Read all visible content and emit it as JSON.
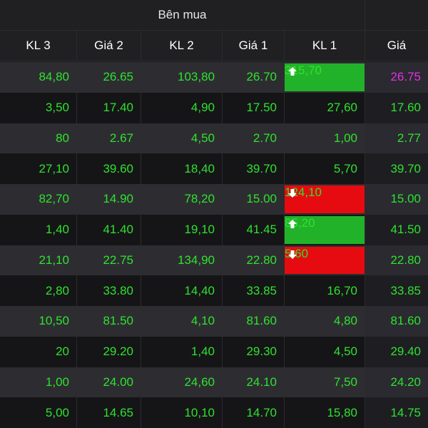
{
  "header": {
    "group_title": "Bên mua",
    "columns": [
      "KL 3",
      "Giá 2",
      "KL 2",
      "Giá 1",
      "KL 1",
      "Giá"
    ]
  },
  "colors": {
    "green_text": "#2fe12f",
    "up_bg": "#22b229",
    "down_bg": "#e60b10",
    "magenta": "#e62fe6"
  },
  "rows": [
    {
      "kl3": "84,80",
      "gia2": "26.65",
      "kl2": "103,80",
      "gia1": "26.70",
      "kl1": "315,70",
      "kl1_state": "up",
      "gia": "26.75",
      "gia_color": "magenta"
    },
    {
      "kl3": "3,50",
      "gia2": "17.40",
      "kl2": "4,90",
      "gia1": "17.50",
      "kl1": "27,60",
      "kl1_state": "none",
      "gia": "17.60",
      "gia_color": "green"
    },
    {
      "kl3": "80",
      "gia2": "2.67",
      "kl2": "4,50",
      "gia1": "2.70",
      "kl1": "1,00",
      "kl1_state": "none",
      "gia": "2.77",
      "gia_color": "green"
    },
    {
      "kl3": "27,10",
      "gia2": "39.60",
      "kl2": "18,40",
      "gia1": "39.70",
      "kl1": "5,70",
      "kl1_state": "none",
      "gia": "39.70",
      "gia_color": "green"
    },
    {
      "kl3": "82,70",
      "gia2": "14.90",
      "kl2": "78,20",
      "gia1": "15.00",
      "kl1": "124,10",
      "kl1_state": "down",
      "gia": "15.00",
      "gia_color": "green"
    },
    {
      "kl3": "1,40",
      "gia2": "41.40",
      "kl2": "19,10",
      "gia1": "41.45",
      "kl1": "85,20",
      "kl1_state": "up",
      "gia": "41.50",
      "gia_color": "green"
    },
    {
      "kl3": "21,10",
      "gia2": "22.75",
      "kl2": "134,90",
      "gia1": "22.80",
      "kl1": "5,60",
      "kl1_state": "down",
      "gia": "22.80",
      "gia_color": "green"
    },
    {
      "kl3": "2,80",
      "gia2": "33.80",
      "kl2": "14,40",
      "gia1": "33.85",
      "kl1": "16,70",
      "kl1_state": "none",
      "gia": "33.85",
      "gia_color": "green"
    },
    {
      "kl3": "10,50",
      "gia2": "81.50",
      "kl2": "4,10",
      "gia1": "81.60",
      "kl1": "4,80",
      "kl1_state": "none",
      "gia": "81.60",
      "gia_color": "green"
    },
    {
      "kl3": "20",
      "gia2": "29.20",
      "kl2": "1,40",
      "gia1": "29.30",
      "kl1": "4,50",
      "kl1_state": "none",
      "gia": "29.40",
      "gia_color": "green"
    },
    {
      "kl3": "1,00",
      "gia2": "24.00",
      "kl2": "24,60",
      "gia1": "24.10",
      "kl1": "7,50",
      "kl1_state": "none",
      "gia": "24.20",
      "gia_color": "green"
    },
    {
      "kl3": "5,00",
      "gia2": "14.65",
      "kl2": "10,10",
      "gia1": "14.70",
      "kl1": "15,80",
      "kl1_state": "none",
      "gia": "14.75",
      "gia_color": "green"
    }
  ]
}
